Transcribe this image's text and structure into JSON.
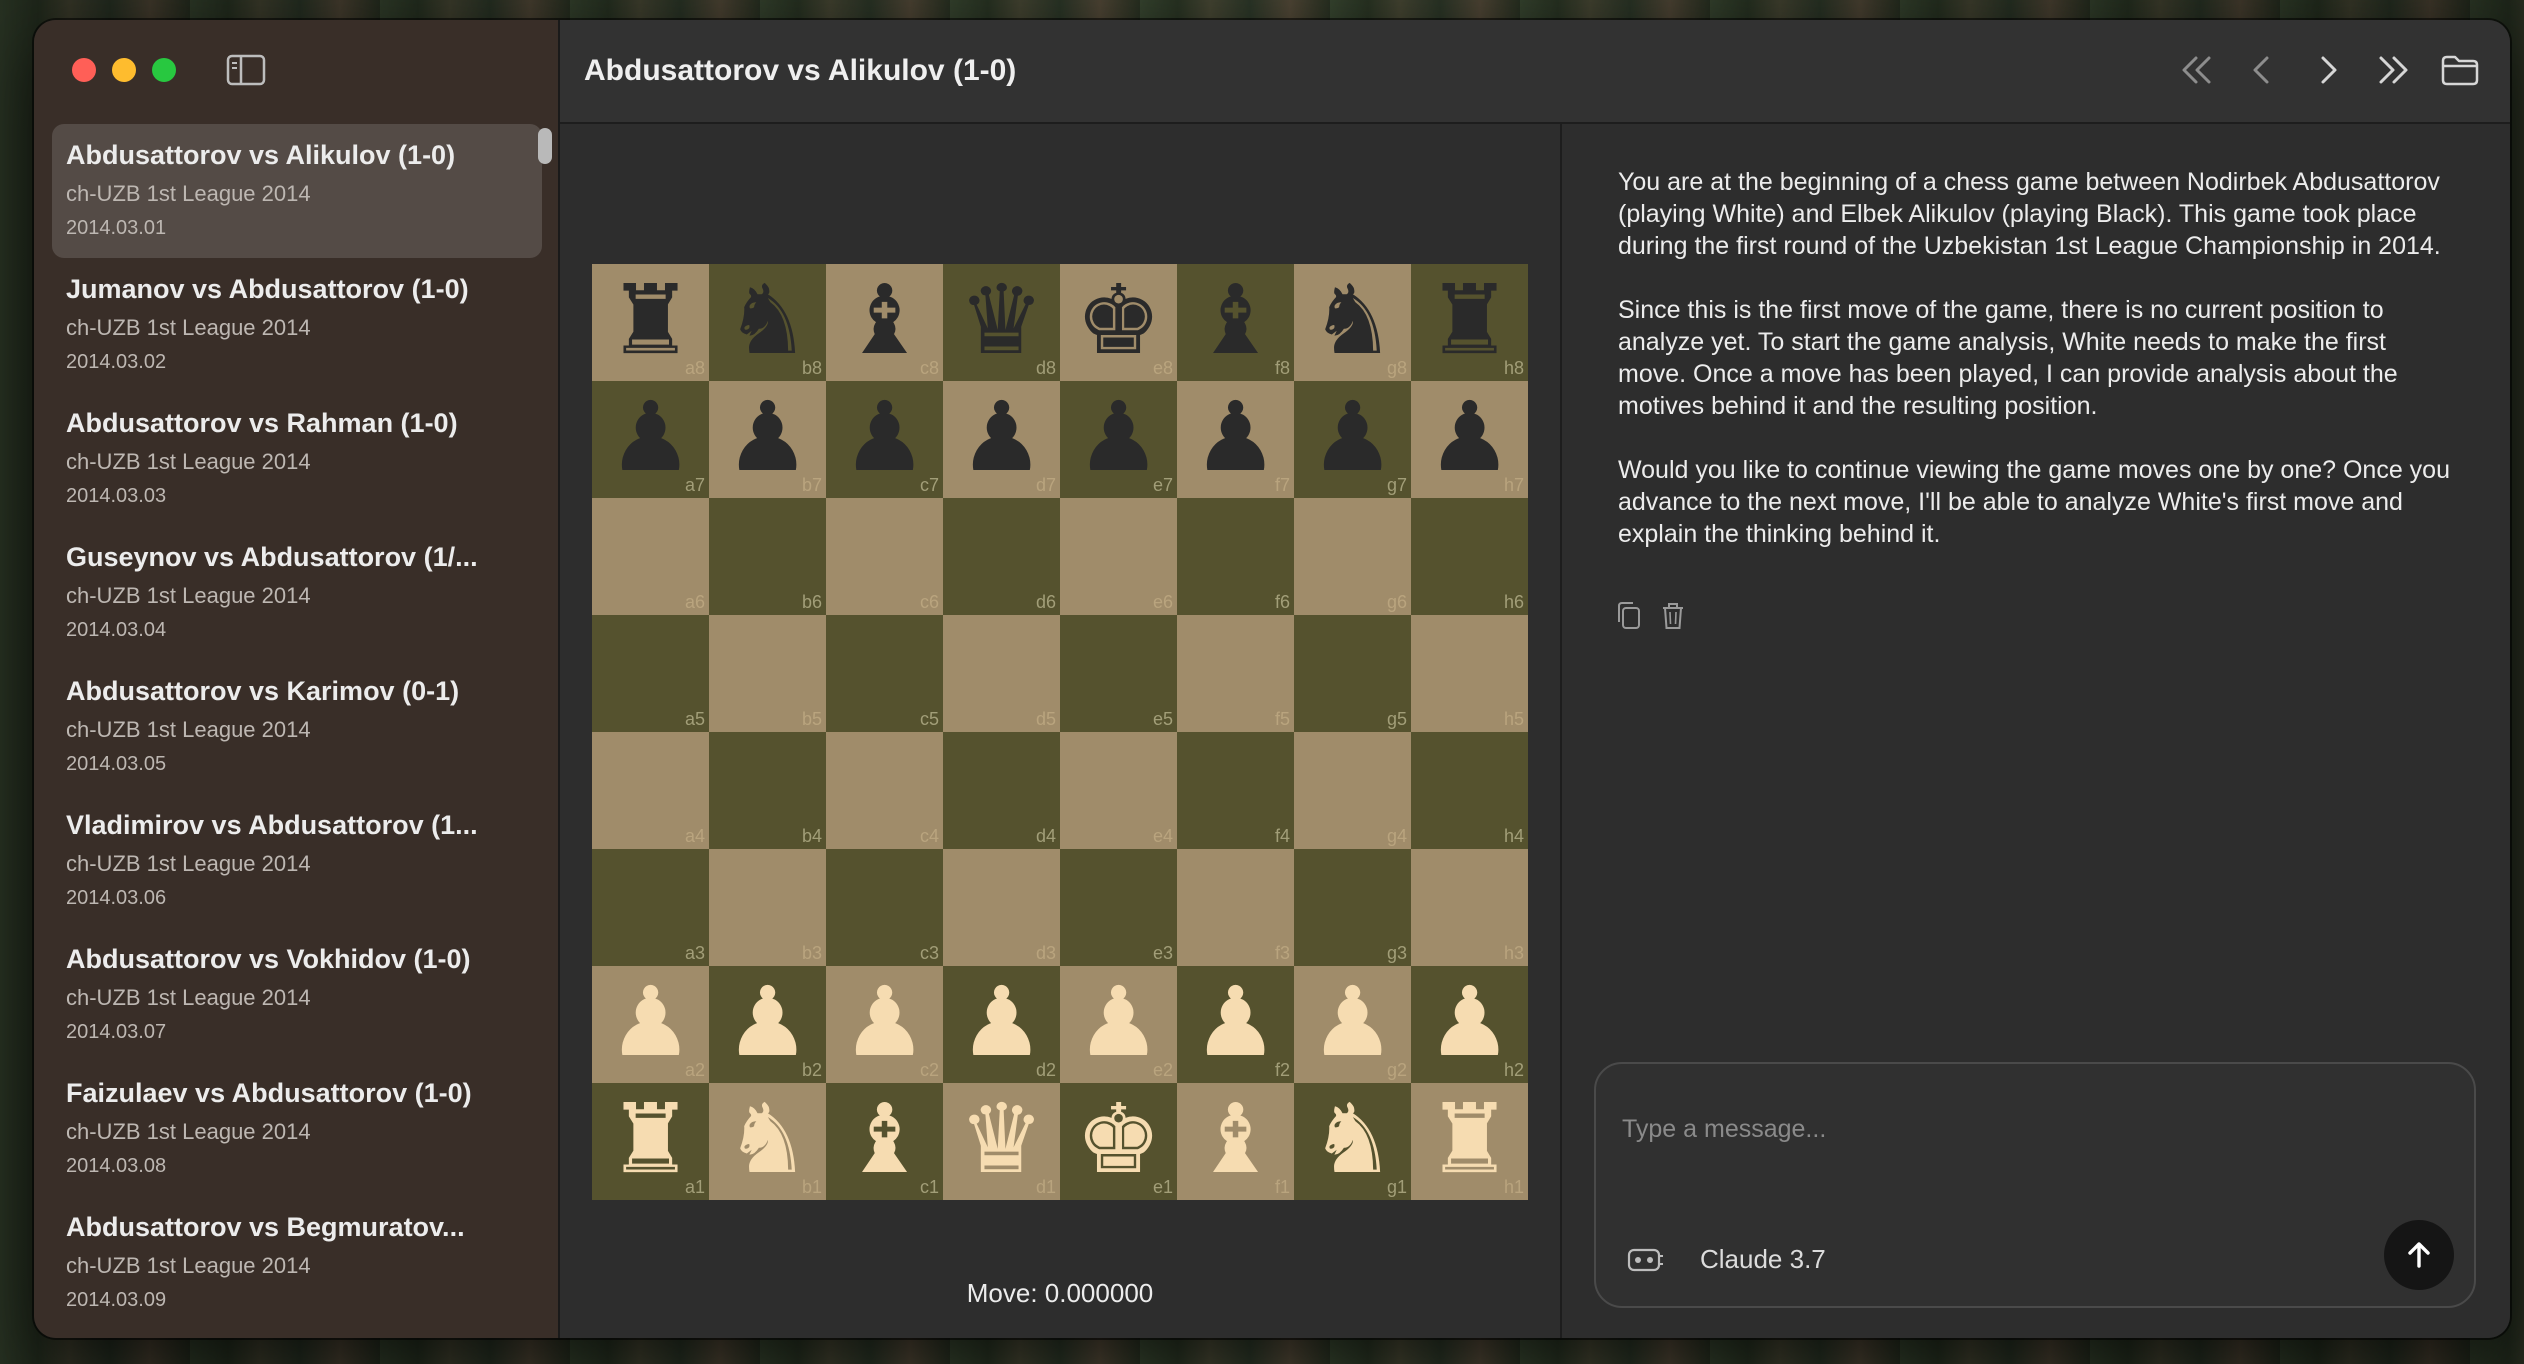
{
  "header": {
    "title": "Abdusattorov vs Alikulov (1-0)"
  },
  "nav": {
    "first_icon": "chevrons-left-icon",
    "prev_icon": "chevron-left-icon",
    "next_icon": "chevron-right-icon",
    "last_icon": "chevrons-right-icon",
    "open_icon": "folder-icon"
  },
  "sidebar": {
    "games": [
      {
        "title": "Abdusattorov vs Alikulov (1-0)",
        "event": "ch-UZB 1st League 2014",
        "date": "2014.03.01",
        "selected": true
      },
      {
        "title": "Jumanov vs Abdusattorov (1-0)",
        "event": "ch-UZB 1st League 2014",
        "date": "2014.03.02"
      },
      {
        "title": "Abdusattorov vs Rahman (1-0)",
        "event": "ch-UZB 1st League 2014",
        "date": "2014.03.03"
      },
      {
        "title": "Guseynov vs Abdusattorov (1/...",
        "event": "ch-UZB 1st League 2014",
        "date": "2014.03.04"
      },
      {
        "title": "Abdusattorov vs Karimov (0-1)",
        "event": "ch-UZB 1st League 2014",
        "date": "2014.03.05"
      },
      {
        "title": "Vladimirov vs Abdusattorov (1...",
        "event": "ch-UZB 1st League 2014",
        "date": "2014.03.06"
      },
      {
        "title": "Abdusattorov vs Vokhidov (1-0)",
        "event": "ch-UZB 1st League 2014",
        "date": "2014.03.07"
      },
      {
        "title": "Faizulaev vs Abdusattorov (1-0)",
        "event": "ch-UZB 1st League 2014",
        "date": "2014.03.08"
      },
      {
        "title": "Abdusattorov vs Begmuratov...",
        "event": "ch-UZB 1st League 2014",
        "date": "2014.03.09"
      }
    ]
  },
  "board": {
    "ranks": [
      [
        "bR",
        "bN",
        "bB",
        "bQ",
        "bK",
        "bB",
        "bN",
        "bR"
      ],
      [
        "bP",
        "bP",
        "bP",
        "bP",
        "bP",
        "bP",
        "bP",
        "bP"
      ],
      [
        "",
        "",
        "",
        "",
        "",
        "",
        "",
        ""
      ],
      [
        "",
        "",
        "",
        "",
        "",
        "",
        "",
        ""
      ],
      [
        "",
        "",
        "",
        "",
        "",
        "",
        "",
        ""
      ],
      [
        "",
        "",
        "",
        "",
        "",
        "",
        "",
        ""
      ],
      [
        "wP",
        "wP",
        "wP",
        "wP",
        "wP",
        "wP",
        "wP",
        "wP"
      ],
      [
        "wR",
        "wN",
        "wB",
        "wQ",
        "wK",
        "wB",
        "wN",
        "wR"
      ]
    ],
    "light_color": "#a08c6a",
    "dark_color": "#55522e",
    "move_label": "Move: 0.000000"
  },
  "chat": {
    "message": [
      "You are at the beginning of a chess game between Nodirbek Abdusattorov (playing White) and Elbek Alikulov (playing Black). This game took place during the first round of the Uzbekistan 1st League Championship in 2014.",
      "Since this is the first move of the game, there is no current position to analyze yet. To start the game analysis, White needs to make the first move. Once a move has been played, I can provide analysis about the motives behind it and the resulting position.",
      "Would you like to continue viewing the game moves one by one? Once you advance to the next move, I'll be able to analyze White's first move and explain the thinking behind it."
    ],
    "input_placeholder": "Type a message...",
    "model_label": "Claude 3.7"
  }
}
